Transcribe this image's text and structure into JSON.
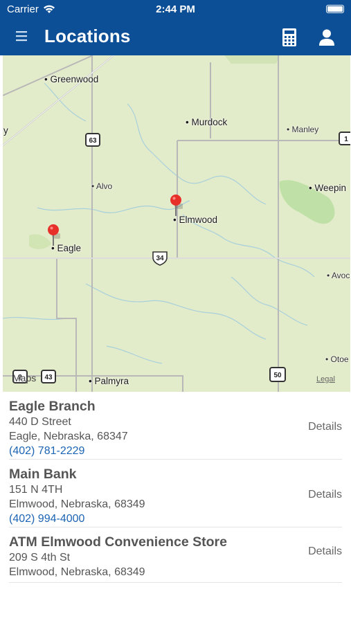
{
  "status_bar": {
    "carrier": "Carrier",
    "time": "2:44 PM"
  },
  "header": {
    "title": "Locations"
  },
  "map": {
    "places": [
      "Greenwood",
      "Murdock",
      "Manley",
      "Alvo",
      "Weepin",
      "Elmwood",
      "Eagle",
      "Avoc",
      "Otoe",
      "Palmyra",
      "ly"
    ],
    "highways": [
      "63",
      "34",
      "50",
      "2",
      "43",
      "1"
    ],
    "logo_text": "Maps",
    "legal": "Legal"
  },
  "locations": [
    {
      "name": "Eagle Branch",
      "street": "440 D Street",
      "city": "Eagle, Nebraska, 68347",
      "phone": "(402) 781-2229",
      "details": "Details"
    },
    {
      "name": "Main Bank",
      "street": "151 N 4TH",
      "city": "Elmwood, Nebraska, 68349",
      "phone": "(402) 994-4000",
      "details": "Details"
    },
    {
      "name": "ATM Elmwood Convenience Store",
      "street": "209 S 4th St",
      "city": "Elmwood, Nebraska, 68349",
      "phone": "",
      "details": "Details"
    }
  ]
}
